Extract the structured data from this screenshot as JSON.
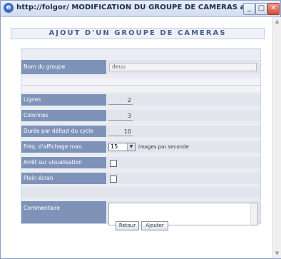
{
  "window": {
    "title": "http://folgor/  MODIFICATION DU GROUPE DE CAMERAS   admi...",
    "min_label": "_",
    "max_label": "□",
    "close_label": "✕"
  },
  "page": {
    "heading": "AJOUT D'UN GROUPE DE CAMERAS"
  },
  "form": {
    "group_name": {
      "label": "Nom du groupe",
      "value": "deuu"
    },
    "rows": {
      "label": "Lignes",
      "value": "2"
    },
    "columns": {
      "label": "Colonnes",
      "value": "3"
    },
    "cycle_duration": {
      "label": "Durée par défaut du cycle",
      "value": "10"
    },
    "display_freq": {
      "label": "Fréq. d'affichage max.",
      "value": "15",
      "unit": "images par seconde"
    },
    "stop_on_view": {
      "label": "Arrêt sur visualisation",
      "checked": false
    },
    "fullscreen": {
      "label": "Plein écran",
      "checked": false
    },
    "comment": {
      "label": "Commentaire",
      "value": ""
    }
  },
  "buttons": {
    "back": "Retour",
    "add": "Ajouter"
  }
}
